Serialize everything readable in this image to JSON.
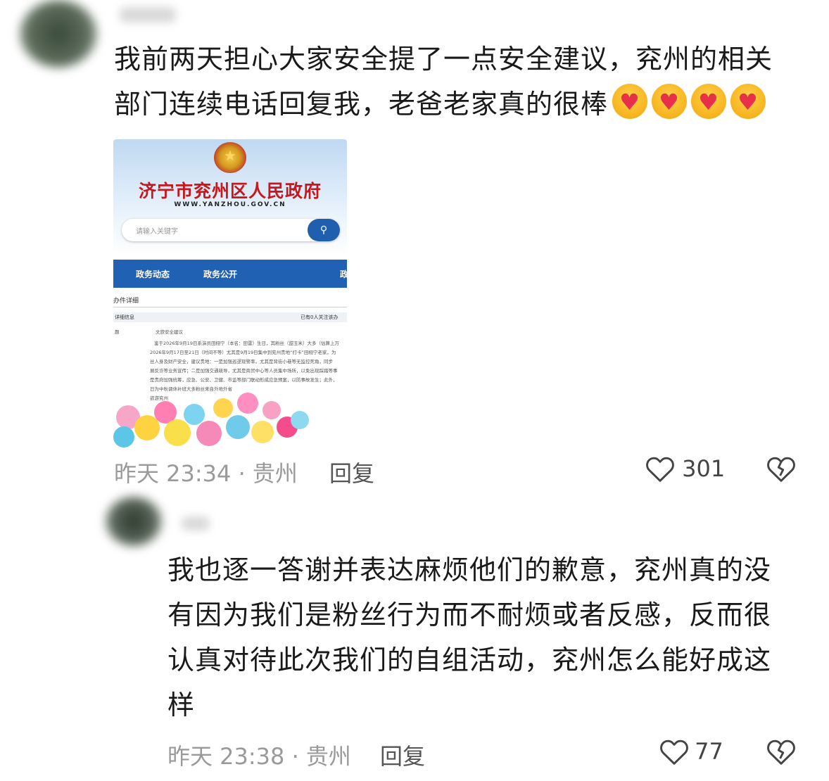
{
  "comments": [
    {
      "text_line1": "我前两天担心大家安全提了一点安全建议，兖州的相关",
      "text_line2": "部门连续电话回复我，老爸老家真的很棒",
      "emoji_count": 4,
      "emoji_name": "heart-hug-emoji",
      "time": "昨天 23:34 · 贵州",
      "reply_label": "回复",
      "like_count": "301",
      "screenshot": {
        "gov_title": "济宁市兖州区人民政府",
        "gov_url": "WWW.YANZHOU.GOV.CN",
        "search_placeholder": "请输入关键字",
        "nav_items": [
          "政务动态",
          "政务公开",
          "政"
        ],
        "detail_heading": "办件详细",
        "detail_info_label": "详细信息",
        "detail_follow": "已有0人关注该办",
        "row_label": "题",
        "row_title": "文旅安全建议",
        "body_lines": [
          "鉴于2026年9月19日系演员田栩宁（本名：田雷）生日，其粉丝（甜玉米）大多（估算上万",
          "2026年9月17日至21日（时间不等）尤其是9月19日集中到兖州贵地“打卡”田栩宁老家，为",
          "丝人身及财产安全，建议贵地：一是加强巡逻现警率，尤其是背街小巷等无监控死角，同步",
          "展反诈等业务宣传；二是加强交通疏导，尤其是商贸中心等人员集中场所，以免出现踩踏等事",
          "是贵府加强统筹，应急、公安、卫健、市监等部门联动形成应急预案，以防事故发生；此外，",
          "日为中秋调休补班大多粉丝来自外地外省",
          "欲游兖州"
        ]
      }
    },
    {
      "text_line1": "我也逐一答谢并表达麻烦他们的歉意，兖州真的没",
      "text_line2": "有因为我们是粉丝行为而不耐烦或者反感，反而很",
      "text_line3": "认真对待此次我们的自组活动，兖州怎么能好成这",
      "text_line4": "样",
      "time": "昨天 23:38 · 贵州",
      "reply_label": "回复",
      "like_count": "77"
    }
  ],
  "colors": {
    "gov_red": "#c8161d",
    "nav_blue": "#2161b3",
    "meta_gray": "#9a9a9a"
  }
}
